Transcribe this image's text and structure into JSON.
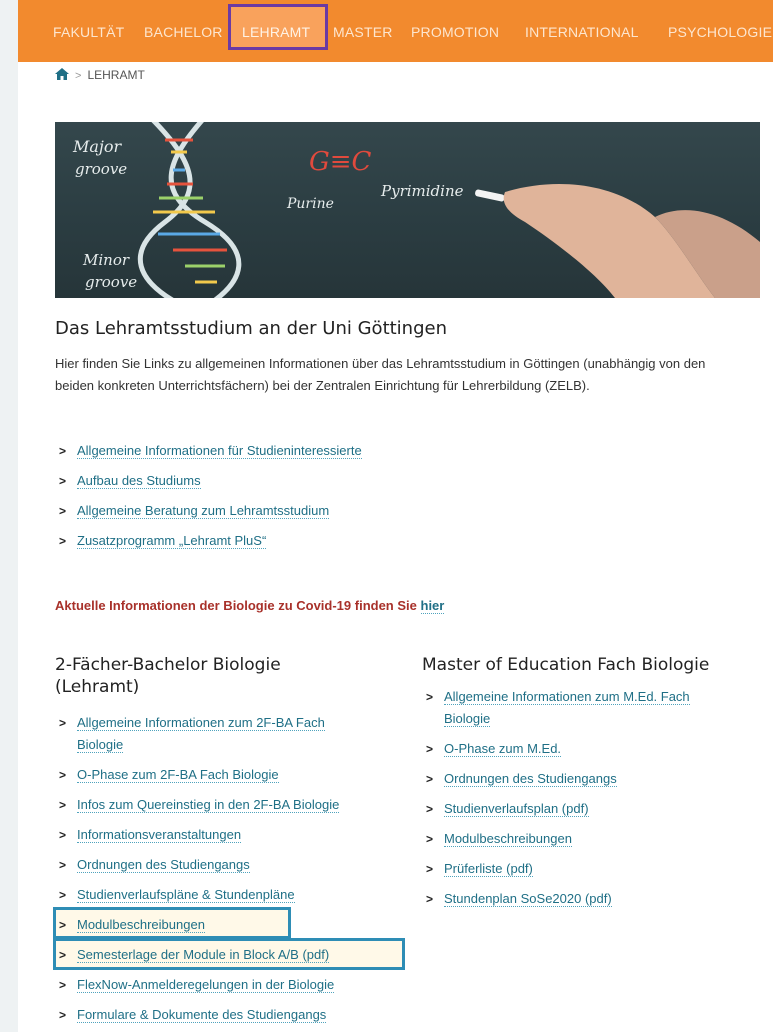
{
  "nav": {
    "items": [
      "FAKULTÄT",
      "BACHELOR",
      "LEHRAMT",
      "MASTER",
      "PROMOTION",
      "INTERNATIONAL",
      "PSYCHOLOGIE"
    ]
  },
  "breadcrumb": {
    "current": "LEHRAMT"
  },
  "hero": {
    "texts": [
      "Major",
      "groove",
      "Minor",
      "groove",
      "G≡C",
      "Purine",
      "Pyrimidine"
    ]
  },
  "intro": {
    "title": "Das Lehramtsstudium an der Uni Göttingen",
    "text": "Hier finden Sie Links zu allgemeinen Informationen über das Lehramtsstudium in Göttingen (unabhängig von den beiden konkreten Unterrichtsfächern) bei der Zentralen Einrichtung für Lehrerbildung (ZELB).",
    "links": [
      "Allgemeine Informationen für Studieninteressierte",
      "Aufbau des Studiums",
      "Allgemeine Beratung zum Lehramtsstudium",
      "Zusatzprogramm „Lehramt PluS“"
    ]
  },
  "covid": {
    "text": "Aktuelle Informationen der Biologie zu Covid-19 finden Sie ",
    "link": "hier"
  },
  "bachelor": {
    "title_line1": "2-Fächer-Bachelor Biologie",
    "title_line2": "(Lehramt)",
    "links": [
      "Allgemeine Informationen zum 2F-BA Fach",
      "Biologie",
      "O-Phase zum 2F-BA Fach Biologie",
      "Infos zum Quereinstieg in den 2F-BA Biologie",
      "Informationsveranstaltungen",
      "Ordnungen des Studiengangs",
      "Studienverlaufspläne & Stundenpläne",
      "Modulbeschreibungen",
      "Semesterlage der Module in Block A/B (pdf)",
      "FlexNow-Anmelderegelungen in der Biologie",
      "Formulare & Dokumente des Studiengangs"
    ]
  },
  "master": {
    "title": "Master of Education Fach Biologie",
    "links": [
      "Allgemeine Informationen zum M.Ed. Fach",
      "Biologie",
      "O-Phase zum M.Ed.",
      "Ordnungen des Studiengangs",
      "Studienverlaufsplan (pdf)",
      "Modulbeschreibungen",
      "Prüferliste (pdf)",
      "Stundenplan SoSe2020 (pdf)"
    ]
  },
  "colors": {
    "nav_bg": "#f28a2e",
    "active_border": "#6b3aa3",
    "link": "#1f6f86",
    "covid": "#a8312a",
    "highlight_border": "#2e8db5"
  }
}
